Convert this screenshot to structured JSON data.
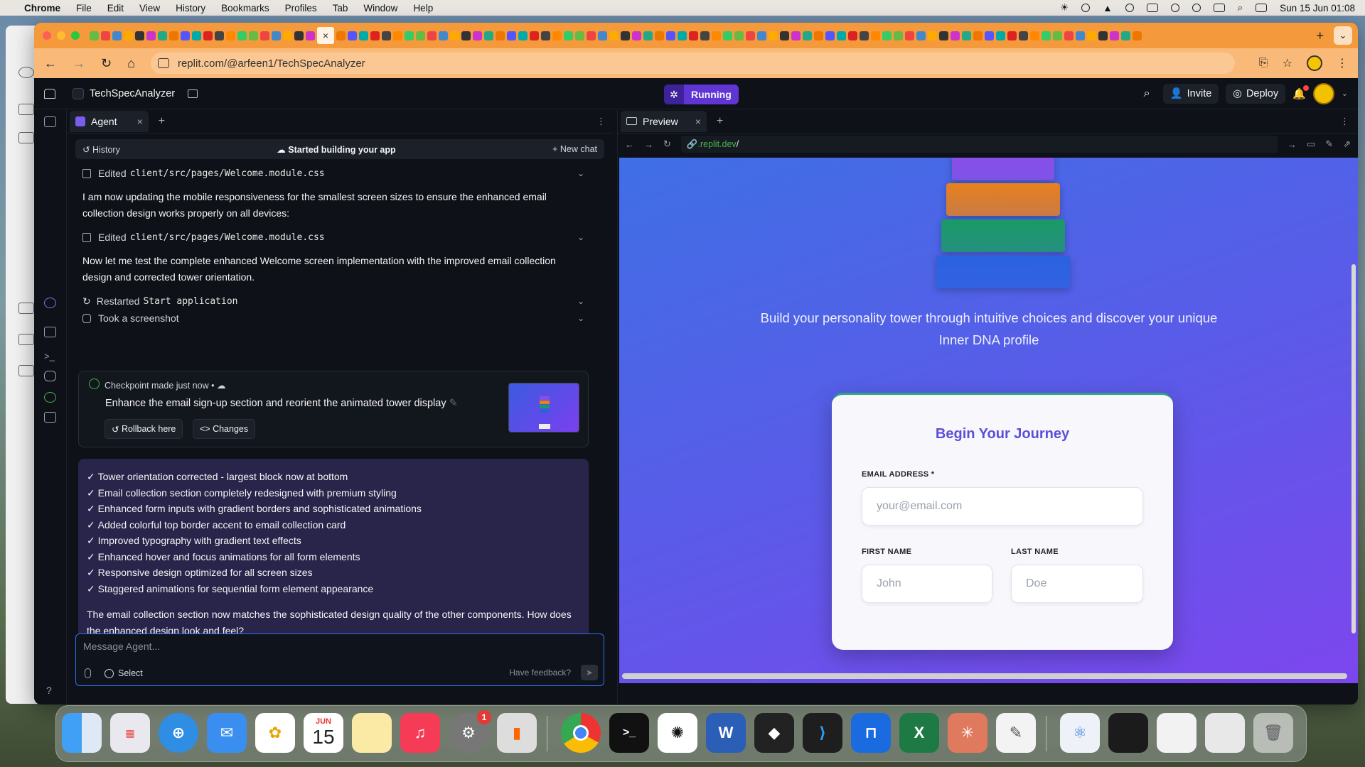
{
  "menubar": {
    "app": "Chrome",
    "items": [
      "File",
      "Edit",
      "View",
      "History",
      "Bookmarks",
      "Profiles",
      "Tab",
      "Window",
      "Help"
    ],
    "datetime": "Sun 15 Jun  01:08"
  },
  "browser": {
    "url": "replit.com/@arfeen1/TechSpecAnalyzer"
  },
  "replit": {
    "repl_name": "TechSpecAnalyzer",
    "status": "Running",
    "invite_label": "Invite",
    "deploy_label": "Deploy"
  },
  "agent": {
    "tab_label": "Agent",
    "history_label": "History",
    "session_title": "Started building your app",
    "new_chat_label": "New chat",
    "log": [
      {
        "type": "edit",
        "label": "Edited",
        "path": "client/src/pages/Welcome.module.css"
      },
      {
        "type": "text",
        "text": "I am now updating the mobile responsiveness for the smallest screen sizes to ensure the enhanced email collection design works properly on all devices:"
      },
      {
        "type": "edit",
        "label": "Edited",
        "path": "client/src/pages/Welcome.module.css"
      },
      {
        "type": "text",
        "text": "Now let me test the complete enhanced Welcome screen implementation with the improved email collection design and corrected tower orientation."
      },
      {
        "type": "restart",
        "label": "Restarted",
        "path": "Start application"
      },
      {
        "type": "screenshot",
        "label": "Took a screenshot"
      }
    ],
    "checkpoint": {
      "meta": "Checkpoint made just now  •",
      "title": "Enhance the email sign-up section and reorient the animated tower display",
      "rollback_label": "Rollback here",
      "changes_label": "Changes"
    },
    "summary_items": [
      "Tower orientation corrected - largest block now at bottom",
      "Email collection section completely redesigned with premium styling",
      "Enhanced form inputs with gradient borders and sophisticated animations",
      "Added colorful top border accent to email collection card",
      "Improved typography with gradient text effects",
      "Enhanced hover and focus animations for all form elements",
      "Responsive design optimized for all screen sizes",
      "Staggered animations for sequential form element appearance"
    ],
    "summary_footer": "The email collection section now matches the sophisticated design quality of the other components. How does the enhanced design look and feel?",
    "input_placeholder": "Message Agent...",
    "select_label": "Select",
    "feedback_label": "Have feedback?"
  },
  "preview": {
    "tab_label": "Preview",
    "url_domain": ".replit.dev",
    "url_path": "/",
    "tagline": "Build your personality tower through intuitive choices and discover your unique Inner DNA profile",
    "card_title": "Begin Your Journey",
    "email_label": "EMAIL ADDRESS *",
    "email_placeholder": "your@email.com",
    "first_label": "FIRST NAME",
    "first_placeholder": "John",
    "last_label": "LAST NAME",
    "last_placeholder": "Doe",
    "tower_colors": [
      "#8a4ee8",
      "#e8801c",
      "#1a9a66",
      "#2a62e0"
    ]
  },
  "dock": {
    "calendar_month": "JUN",
    "calendar_day": "15",
    "settings_badge": "1"
  }
}
